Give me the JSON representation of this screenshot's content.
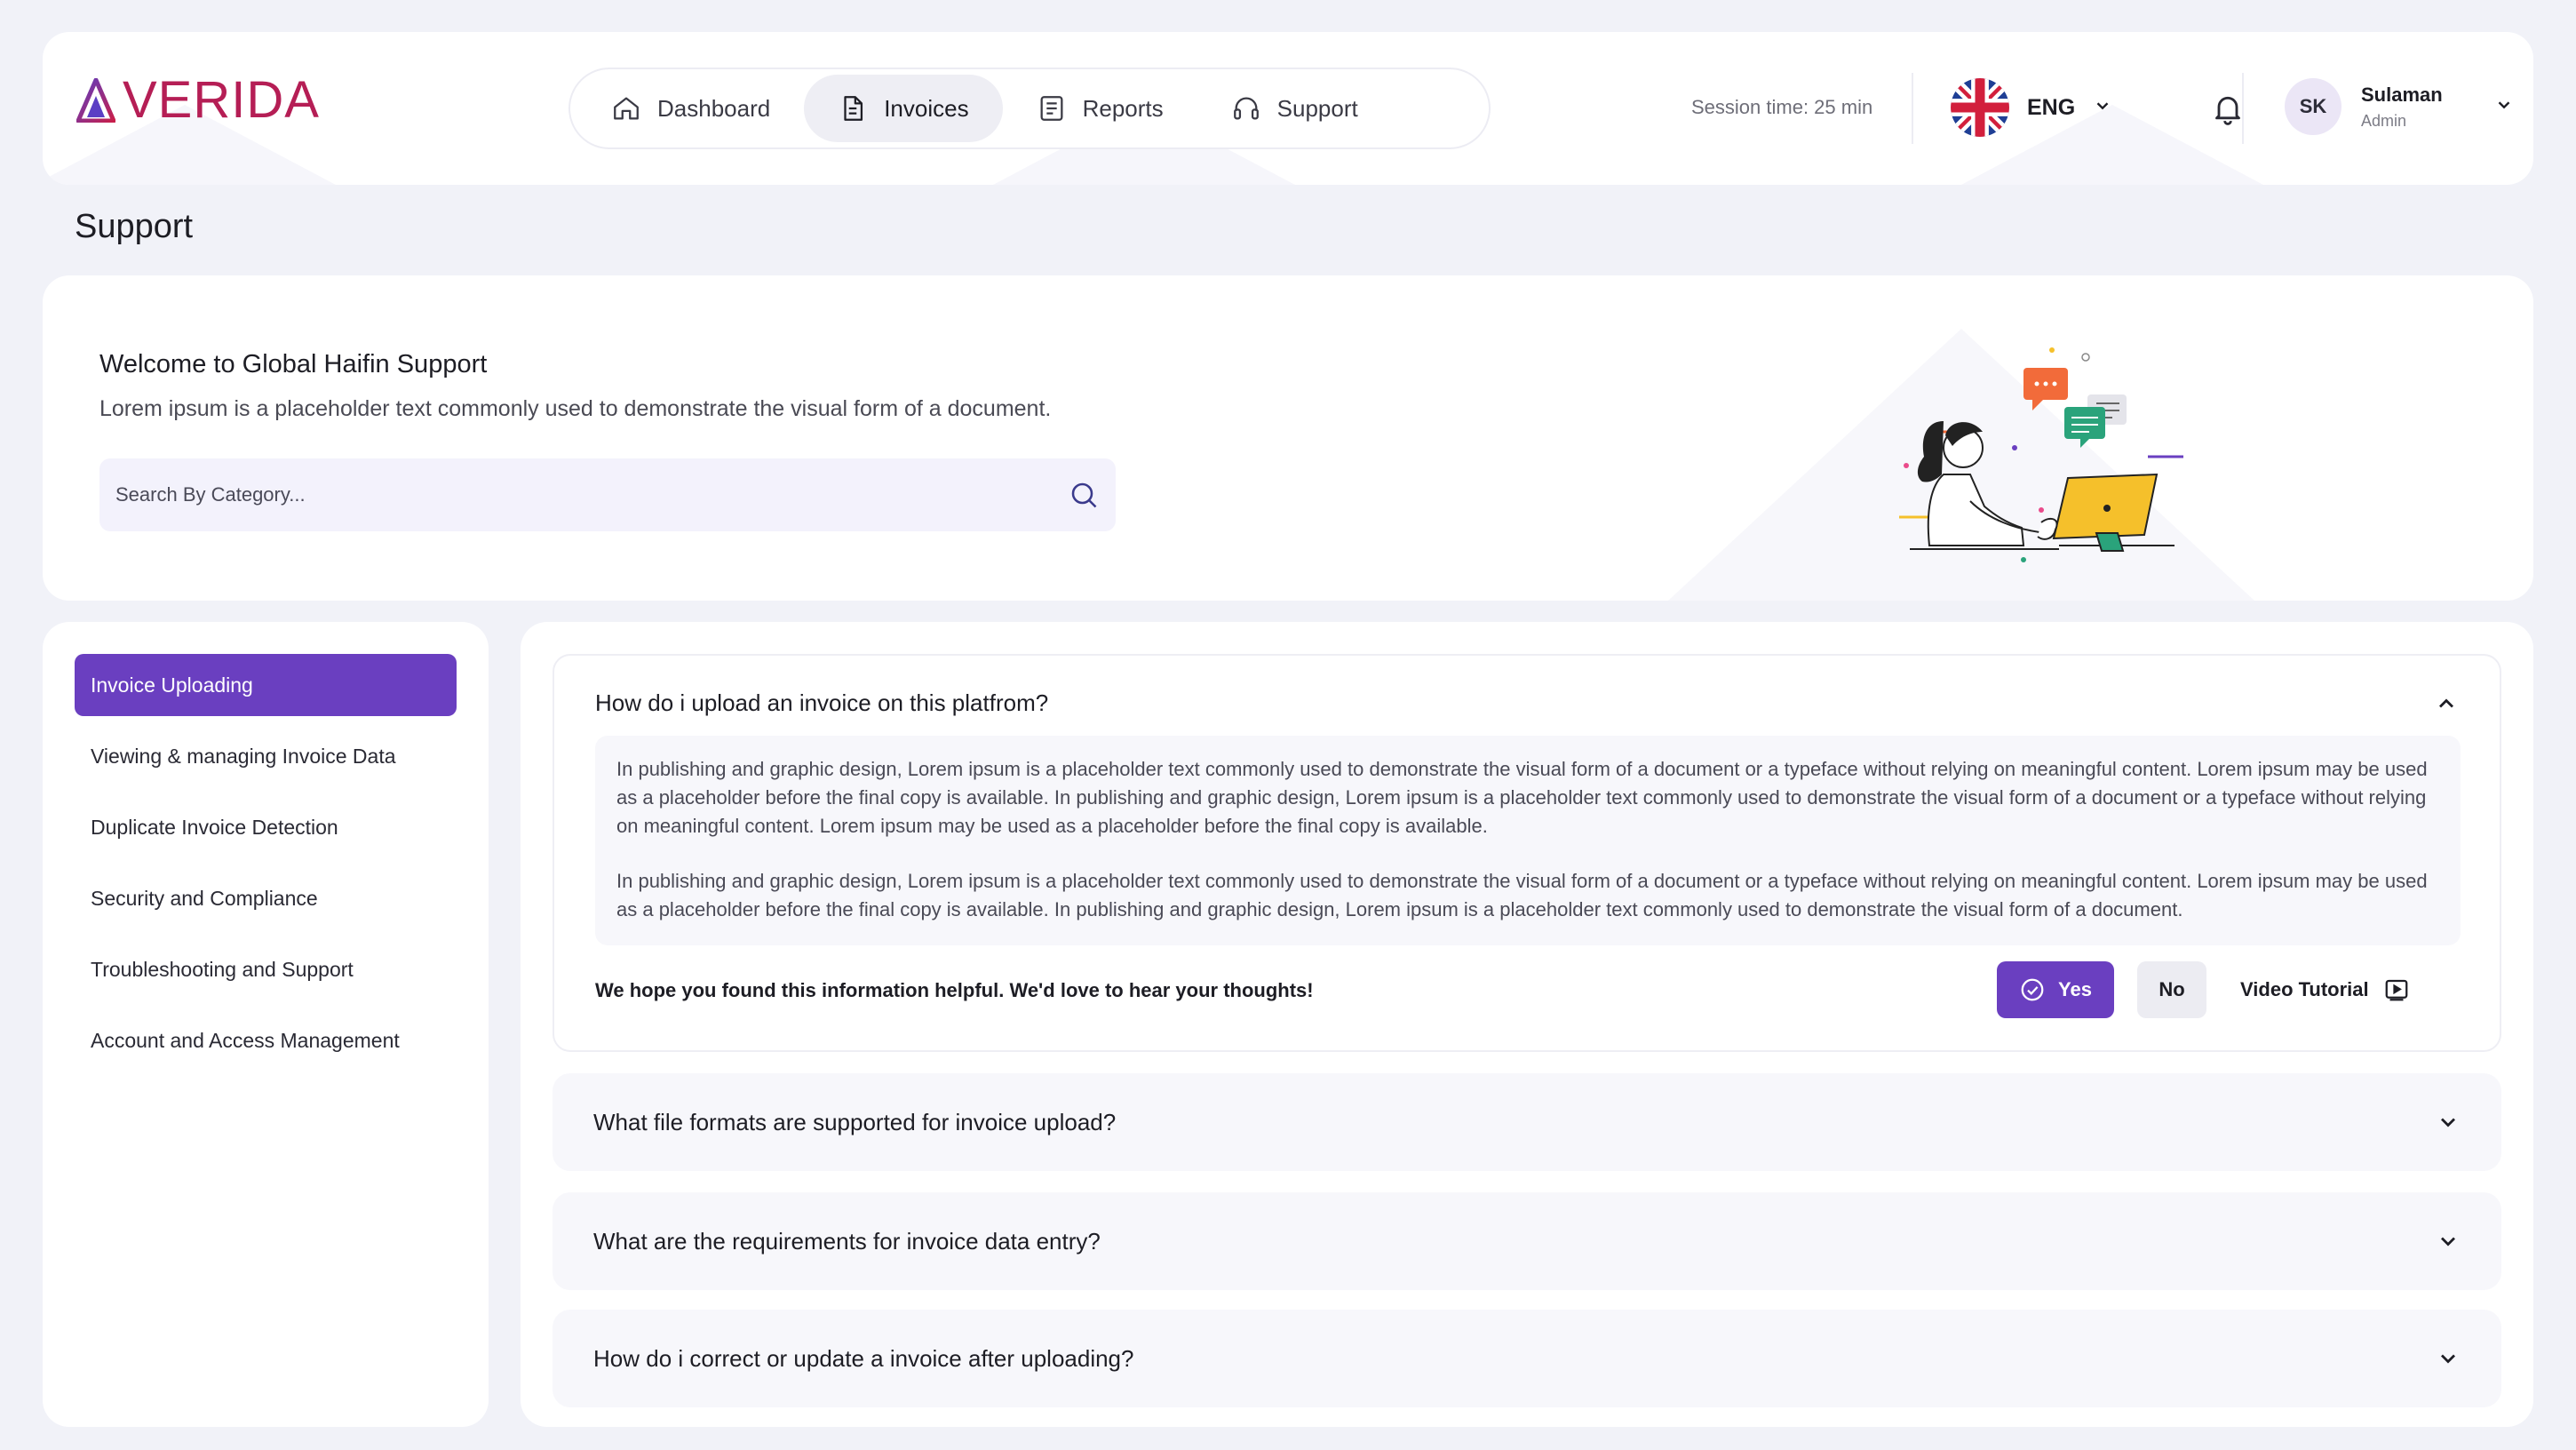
{
  "brand": {
    "name": "VERIDA"
  },
  "nav": {
    "items": [
      {
        "label": "Dashboard",
        "icon": "home-icon",
        "active": false
      },
      {
        "label": "Invoices",
        "icon": "document-icon",
        "active": true
      },
      {
        "label": "Reports",
        "icon": "report-icon",
        "active": false
      },
      {
        "label": "Support",
        "icon": "headset-icon",
        "active": false
      }
    ]
  },
  "header": {
    "session_text": "Session time: 25 min",
    "language": "ENG",
    "user": {
      "initials": "SK",
      "name": "Sulaman",
      "role": "Admin"
    }
  },
  "page": {
    "title": "Support"
  },
  "welcome": {
    "title": "Welcome to Global Haifin Support",
    "subtitle": "Lorem ipsum is a placeholder text commonly used to demonstrate the visual form of a document.",
    "search_placeholder": "Search By Category..."
  },
  "sidebar": {
    "items": [
      {
        "label": "Invoice Uploading",
        "active": true
      },
      {
        "label": "Viewing & managing Invoice Data",
        "active": false
      },
      {
        "label": "Duplicate Invoice Detection",
        "active": false
      },
      {
        "label": "Security and Compliance",
        "active": false
      },
      {
        "label": "Troubleshooting and Support",
        "active": false
      },
      {
        "label": "Account and Access Management",
        "active": false
      }
    ]
  },
  "faq": {
    "open": {
      "question": "How do i upload an invoice on this platfrom?",
      "paragraphs": [
        "In publishing and graphic design, Lorem ipsum is a placeholder text commonly used to demonstrate the visual form of a document or a typeface without relying on meaningful content. Lorem ipsum may be used as a placeholder before the final copy is available. In publishing and graphic design, Lorem ipsum is a placeholder text commonly used to demonstrate the visual form of a document or a typeface without relying on meaningful content. Lorem ipsum may be used as a placeholder before the final copy is available.",
        "In publishing and graphic design, Lorem ipsum is a placeholder text commonly used to demonstrate the visual form of a document or a typeface without relying on meaningful content. Lorem ipsum may be used as a placeholder before the final copy is available. In publishing and graphic design, Lorem ipsum is a placeholder text commonly used to demonstrate the visual form of a document."
      ],
      "feedback_prompt": "We hope you found this information helpful. We'd love to hear your thoughts!",
      "yes_label": "Yes",
      "no_label": "No",
      "video_label": "Video Tutorial"
    },
    "closed": [
      {
        "question": "What file formats are supported for invoice upload?"
      },
      {
        "question": "What are the requirements for invoice data entry?"
      },
      {
        "question": "How do i correct or update a invoice after uploading?"
      }
    ]
  },
  "colors": {
    "accent": "#6a3fc0",
    "brand": "#b51e55",
    "background": "#f1f2f8"
  }
}
